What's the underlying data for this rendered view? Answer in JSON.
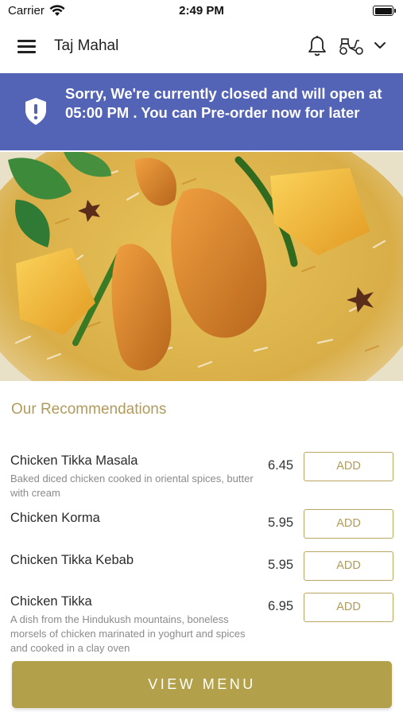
{
  "status_bar": {
    "carrier": "Carrier",
    "time": "2:49 PM"
  },
  "nav": {
    "title": "Taj Mahal",
    "icons": [
      "menu-icon",
      "bell-icon",
      "delivery-scooter-icon",
      "chevron-down-icon"
    ]
  },
  "banner": {
    "message": "Sorry, We're currently closed and will open at 05:00 PM . You can Pre-order now for later",
    "icon": "shield-alert-icon",
    "color": "#5363b5"
  },
  "hero": {
    "description_icon": "biryani-food-photo"
  },
  "recommendations": {
    "title": "Our Recommendations",
    "items": [
      {
        "name": "Chicken Tikka Masala",
        "description": "Baked diced chicken cooked in oriental spices, butter with cream",
        "price": "6.45",
        "button": "ADD"
      },
      {
        "name": "Chicken Korma",
        "description": "",
        "price": "5.95",
        "button": "ADD"
      },
      {
        "name": "Chicken Tikka Kebab",
        "description": "",
        "price": "5.95",
        "button": "ADD"
      },
      {
        "name": "Chicken Tikka",
        "description": "A dish from the Hindukush mountains, boneless morsels of chicken marinated in yoghurt and spices and cooked in a clay oven",
        "price": "6.95",
        "button": "ADD"
      }
    ]
  },
  "footer": {
    "view_menu": "VIEW MENU"
  },
  "colors": {
    "accent_gold": "#b2a04b",
    "banner_blue": "#5363b5"
  }
}
